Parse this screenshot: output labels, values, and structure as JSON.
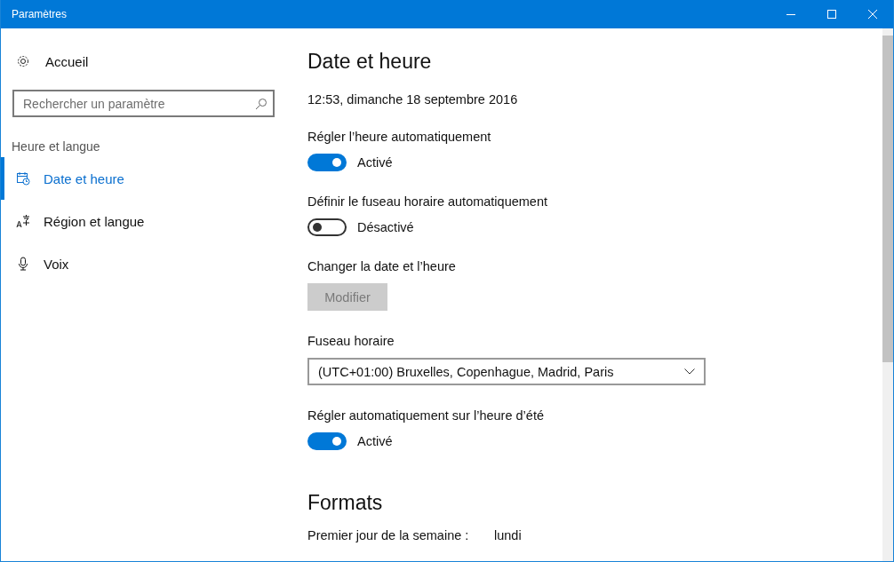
{
  "window": {
    "title": "Paramètres"
  },
  "sidebar": {
    "home": "Accueil",
    "search": {
      "placeholder": "Rechercher un paramètre"
    },
    "section": "Heure et langue",
    "items": [
      {
        "label": "Date et heure",
        "kind": "calendar",
        "selected": true
      },
      {
        "label": "Région et langue",
        "kind": "language",
        "selected": false
      },
      {
        "label": "Voix",
        "kind": "microphone",
        "selected": false
      }
    ]
  },
  "main": {
    "title": "Date et heure",
    "current_time": "12:53, dimanche 18 septembre 2016",
    "settings": [
      {
        "kind": "toggle",
        "label": "Régler l’heure automatiquement",
        "on": true,
        "state_label": "Activé"
      },
      {
        "kind": "toggle",
        "label": "Définir le fuseau horaire automatiquement",
        "on": false,
        "state_label": "Désactivé"
      },
      {
        "kind": "button",
        "label": "Changer la date et l’heure",
        "button": "Modifier",
        "disabled": true
      },
      {
        "kind": "dropdown",
        "label": "Fuseau horaire",
        "value": "(UTC+01:00) Bruxelles, Copenhague, Madrid, Paris"
      },
      {
        "kind": "toggle",
        "label": "Régler automatiquement sur l’heure d’été",
        "on": true,
        "state_label": "Activé"
      }
    ],
    "formats": {
      "title": "Formats",
      "rows": [
        {
          "label": "Premier jour de la semaine :",
          "value": "lundi"
        }
      ]
    }
  }
}
